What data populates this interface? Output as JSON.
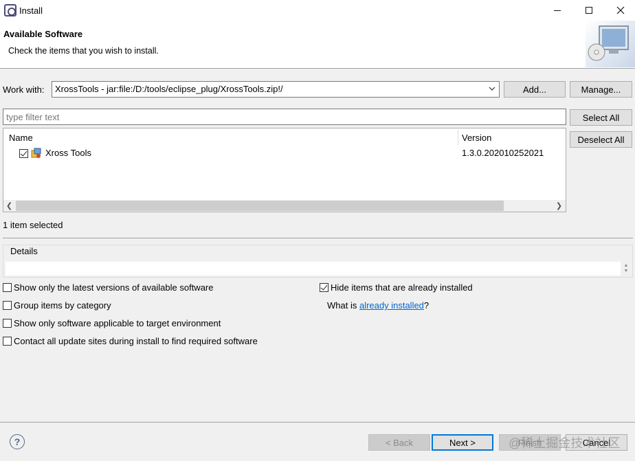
{
  "window": {
    "title": "Install",
    "minimize_icon": "minimize-icon",
    "maximize_icon": "maximize-icon",
    "close_icon": "close-icon"
  },
  "header": {
    "title": "Available Software",
    "description": "Check the items that you wish to install."
  },
  "work_with": {
    "label": "Work with:",
    "value": "XrossTools - jar:file:/D:/tools/eclipse_plug/XrossTools.zip!/",
    "add_label": "Add...",
    "manage_label": "Manage..."
  },
  "filter": {
    "placeholder": "type filter text",
    "select_all_label": "Select All",
    "deselect_all_label": "Deselect All"
  },
  "table": {
    "columns": [
      "Name",
      "Version"
    ],
    "rows": [
      {
        "name": "Xross Tools",
        "version": "1.3.0.202010252021",
        "checked": true
      }
    ]
  },
  "status": {
    "selection_text": "1 item selected"
  },
  "details": {
    "label": "Details"
  },
  "options": {
    "latest_versions": "Show only the latest versions of available software",
    "group_by_category": "Group items by category",
    "target_env": "Show only software applicable to target environment",
    "contact_sites": "Contact all update sites during install to find required software",
    "hide_installed": "Hide items that are already installed",
    "what_is_prefix": "What is ",
    "already_installed_link": "already installed",
    "what_is_suffix": "?"
  },
  "footer": {
    "back_label": "< Back",
    "next_label": "Next >",
    "finish_label": "Finish",
    "cancel_label": "Cancel",
    "watermark": "@稀土掘金技术社区"
  },
  "colors": {
    "accent": "#0078d7",
    "link": "#0066cc"
  }
}
